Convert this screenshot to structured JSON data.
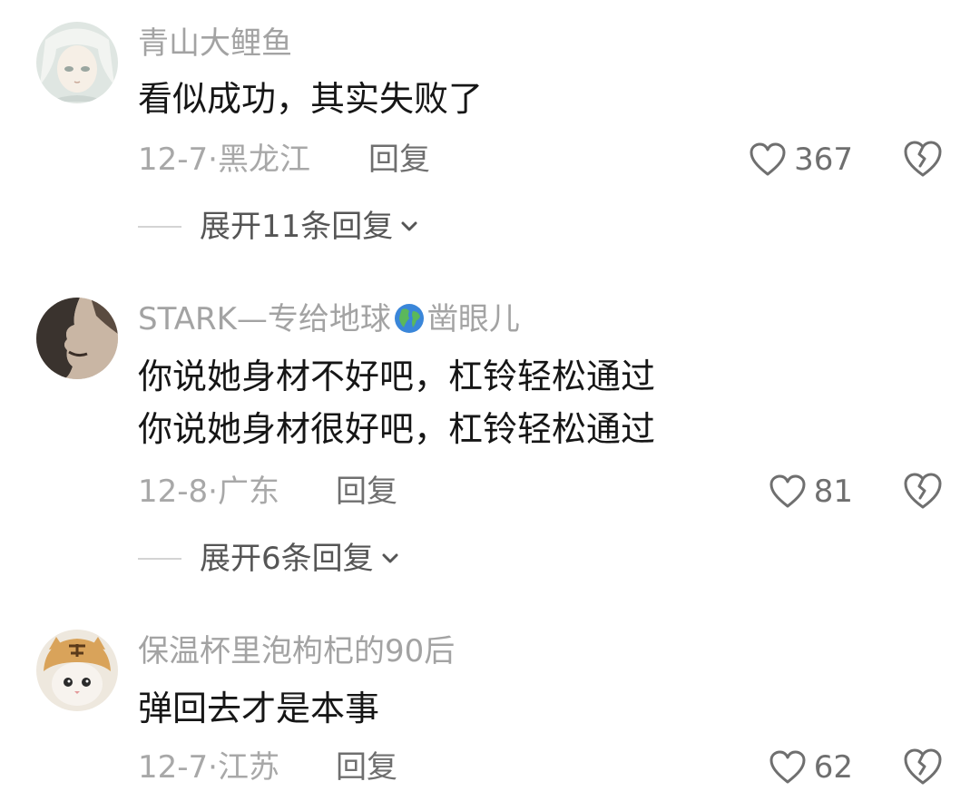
{
  "comments": [
    {
      "username": "青山大鲤鱼",
      "lines": [
        "看似成功，其实失败了"
      ],
      "date": "12-7·",
      "location": "黑龙江",
      "reply_label": "回复",
      "likes": "367",
      "expand_label": "展开11条回复",
      "avatar_icon": "anime-avatar"
    },
    {
      "username_pre": "STARK—专给地球",
      "username_emoji": "earth-globe-icon",
      "username_post": "凿眼儿",
      "lines": [
        "你说她身材不好吧，杠铃轻松通过",
        "你说她身材很好吧，杠铃轻松通过"
      ],
      "date": "12-8·",
      "location": "广东",
      "reply_label": "回复",
      "likes": "81",
      "expand_label": "展开6条回复",
      "avatar_icon": "man-profile-avatar"
    },
    {
      "username": "保温杯里泡枸杞的90后",
      "lines": [
        "弹回去才是本事"
      ],
      "date": "12-7·",
      "location": "江苏",
      "reply_label": "回复",
      "likes": "62",
      "avatar_icon": "tiger-cat-avatar"
    }
  ],
  "colors": {
    "username": "#a3a3a3",
    "body": "#161616",
    "meta": "#a8a8a8",
    "action": "#6f6f6f"
  }
}
